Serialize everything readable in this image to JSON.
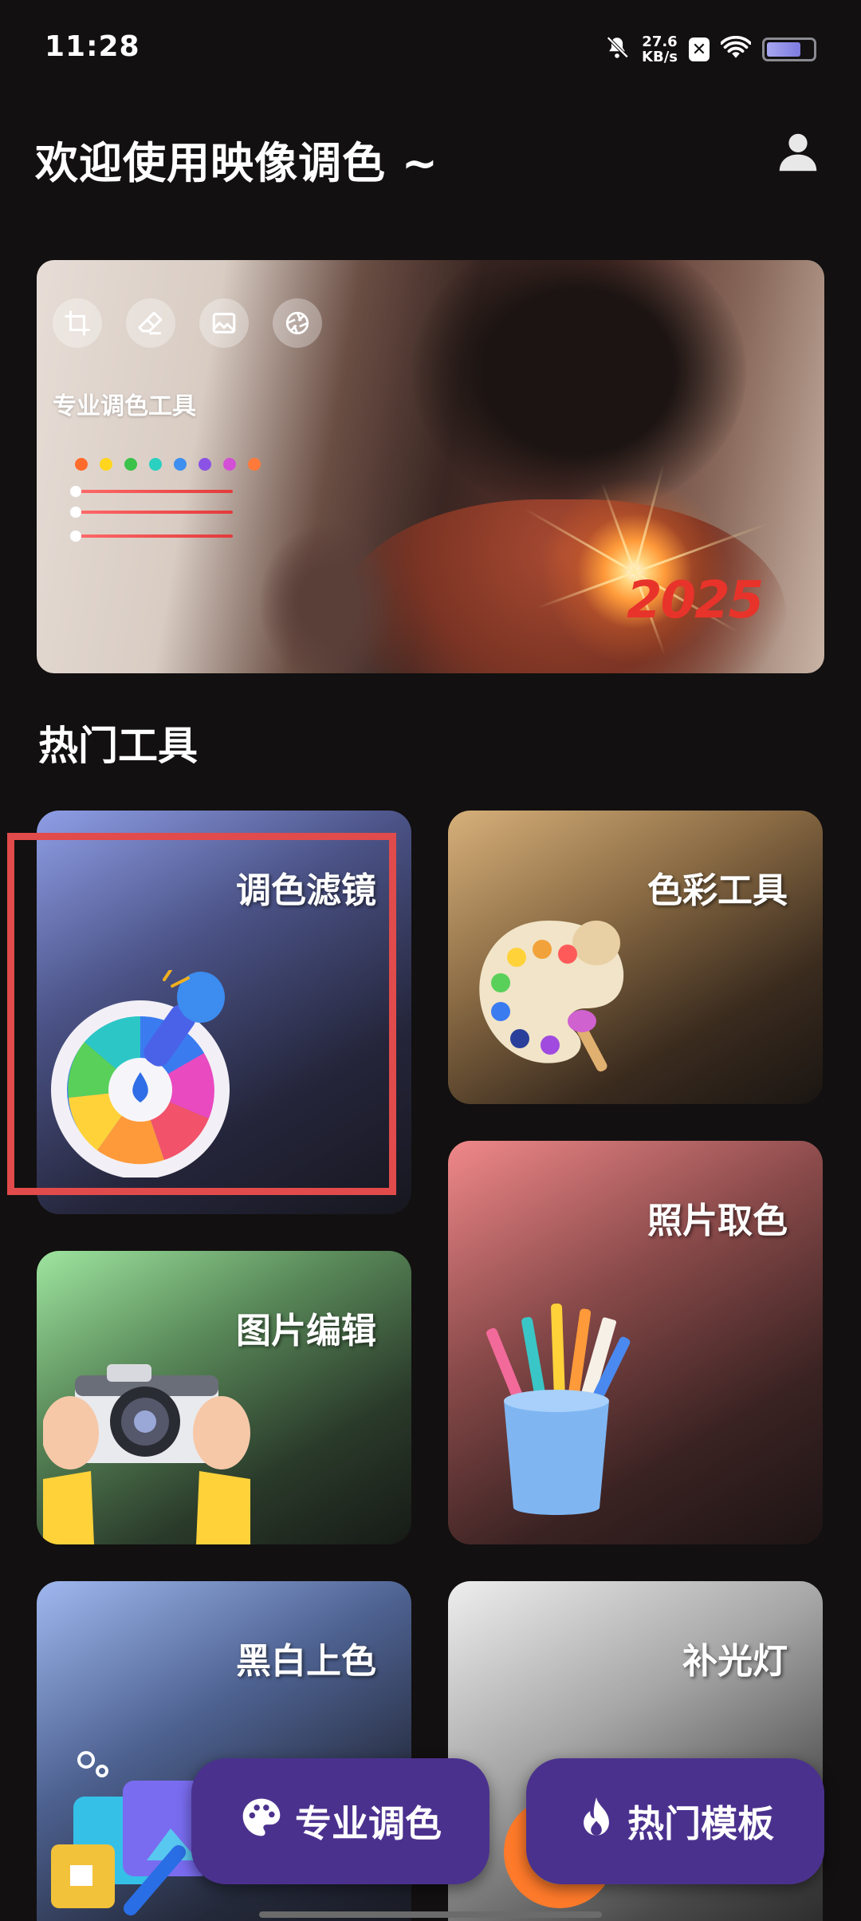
{
  "status_bar": {
    "time": "11:28",
    "net_speed_value": "27.6",
    "net_speed_unit": "KB/s",
    "sim_badge": "✕",
    "icons": [
      "bell-muted-icon",
      "sim-x-icon",
      "wifi-icon",
      "battery-icon"
    ],
    "battery_level": 0.75
  },
  "header": {
    "title": "欢迎使用映像调色 ~",
    "profile_icon": "user-icon"
  },
  "banner": {
    "label": "专业调色工具",
    "icons": [
      "crop-icon",
      "eraser-icon",
      "image-icon",
      "aperture-icon"
    ],
    "swatches": [
      "#ff6b2b",
      "#ffd51e",
      "#3bc24a",
      "#2ad0c0",
      "#3f8ff0",
      "#8a53e6",
      "#d34fd6",
      "#ff7a3a"
    ],
    "year_text": "2025"
  },
  "section": {
    "hot_tools_title": "热门工具"
  },
  "tools": {
    "filter": "调色滤镜",
    "color_tool": "色彩工具",
    "photo_pick": "照片取色",
    "image_edit": "图片编辑",
    "bw_colorize": "黑白上色",
    "fill_light": "补光灯"
  },
  "bottom_bar": {
    "pro_color_label": "专业调色",
    "hot_template_label": "热门模板",
    "pro_color_icon": "palette-icon",
    "hot_template_icon": "flame-icon"
  },
  "colors": {
    "background": "#121010",
    "button_purple": "#4b318e",
    "highlight_red": "#e14b4b"
  }
}
